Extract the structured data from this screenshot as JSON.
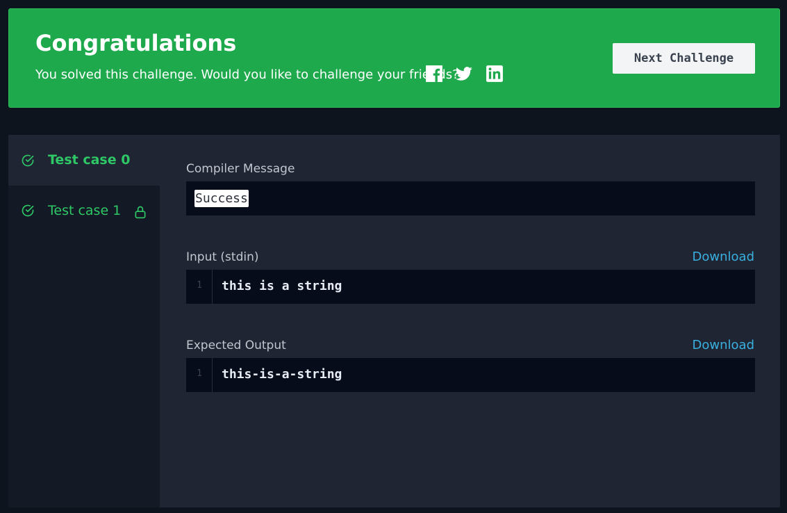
{
  "banner": {
    "title": "Congratulations",
    "subtitle": "You solved this challenge. Would you like to challenge your friends?",
    "social_icons": [
      "facebook-icon",
      "twitter-icon",
      "linkedin-icon"
    ],
    "next_button_label": "Next Challenge",
    "color": "#1ea94c"
  },
  "sidebar": {
    "test_cases": [
      {
        "label": "Test case 0",
        "status": "passed",
        "locked": false,
        "active": true
      },
      {
        "label": "Test case 1",
        "status": "passed",
        "locked": true,
        "active": false
      }
    ],
    "success_color": "#2ec866"
  },
  "main": {
    "compiler_message": {
      "label": "Compiler Message",
      "value": "Success"
    },
    "input": {
      "label": "Input (stdin)",
      "download_label": "Download",
      "line_number": "1",
      "value": "this is a string"
    },
    "expected_output": {
      "label": "Expected Output",
      "download_label": "Download",
      "line_number": "1",
      "value": "this-is-a-string"
    },
    "link_color": "#39b0e0"
  }
}
